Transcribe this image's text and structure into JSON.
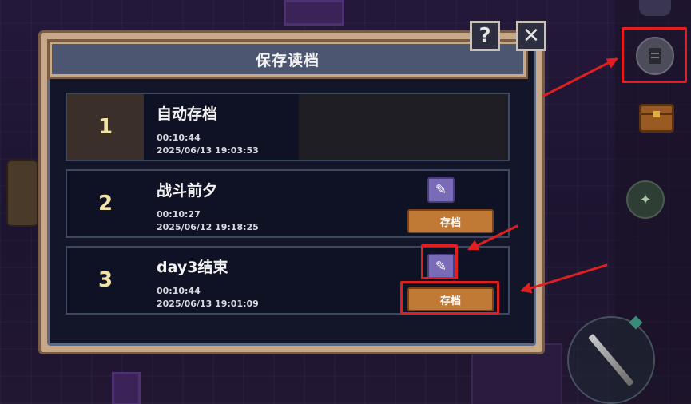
{
  "dialog": {
    "title": "保存读档",
    "help_label": "?",
    "close_label": "✕"
  },
  "slots": [
    {
      "number": "1",
      "name": "自动存档",
      "playtime": "00:10:44",
      "datetime": "2025/06/13 19:03:53"
    },
    {
      "number": "2",
      "name": "战斗前夕",
      "playtime": "00:10:27",
      "datetime": "2025/06/12 19:18:25",
      "save_label": "存档"
    },
    {
      "number": "3",
      "name": "day3结束",
      "playtime": "00:10:44",
      "datetime": "2025/06/13 19:01:09",
      "save_label": "存档"
    }
  ],
  "icons": {
    "edit": "pencil-icon",
    "save": "document-icon",
    "inventory": "chest-icon",
    "map": "map-icon",
    "attack": "sword-icon"
  },
  "colors": {
    "annotation": "#e02020",
    "save_button": "#c07a36",
    "edit_button": "#7a6bb8",
    "panel_border": "#c7a98a",
    "panel_bg": "#131628"
  }
}
